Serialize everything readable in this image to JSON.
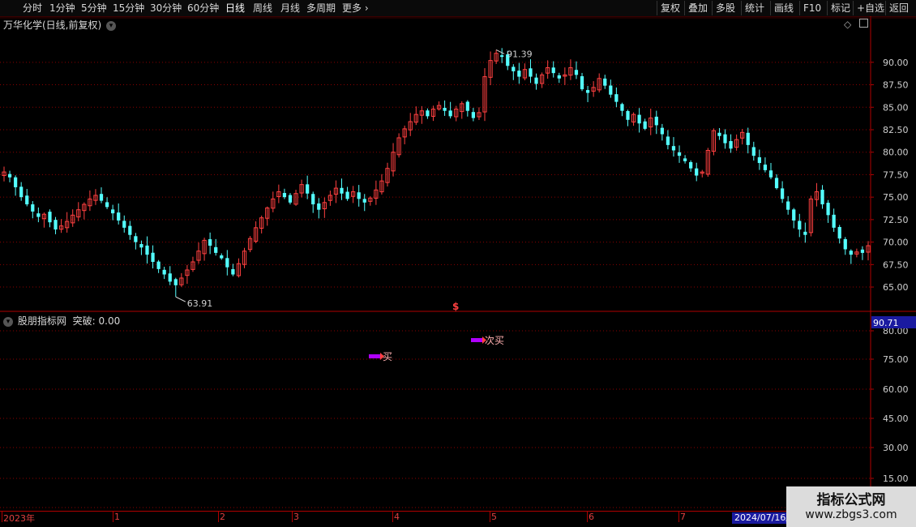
{
  "toolbar": {
    "periods": [
      {
        "label": "分时",
        "active": false
      },
      {
        "label": "1分钟",
        "active": false
      },
      {
        "label": "5分钟",
        "active": false
      },
      {
        "label": "15分钟",
        "active": false
      },
      {
        "label": "30分钟",
        "active": false
      },
      {
        "label": "60分钟",
        "active": false
      },
      {
        "label": "日线",
        "active": true
      },
      {
        "label": "周线",
        "active": false
      },
      {
        "label": "月线",
        "active": false
      },
      {
        "label": "多周期",
        "active": false
      },
      {
        "label": "更多",
        "active": false
      }
    ],
    "right_buttons": [
      "复权",
      "叠加",
      "多股",
      "统计",
      "画线",
      "F10",
      "标记",
      "+自选",
      "返回"
    ]
  },
  "main_panel": {
    "title": "万华化学(日线,前复权)",
    "y_ticks": [
      "90.00",
      "87.50",
      "85.00",
      "82.50",
      "80.00",
      "77.50",
      "75.00",
      "72.50",
      "70.00",
      "67.50",
      "65.00"
    ],
    "high_label": "91.39",
    "low_label": "63.91",
    "marker_symbol": "$"
  },
  "indicator_panel": {
    "title": "股朋指标网",
    "value_label": "突破: 0.00",
    "current_value_box": "90.71",
    "y_ticks": [
      "80.00",
      "75.00",
      "60.00",
      "45.00",
      "30.00",
      "15.00"
    ],
    "signals": [
      {
        "label": "买",
        "color": "#b000ff"
      },
      {
        "label": "次买",
        "color": "#b000ff"
      }
    ]
  },
  "date_axis": {
    "labels": [
      "2023年",
      "1",
      "2",
      "3",
      "4",
      "5",
      "6",
      "7"
    ],
    "current_date": "2024/07/16/"
  },
  "watermark": {
    "line1": "指标公式网",
    "line2": "www.zbgs3.com"
  },
  "colors": {
    "up": "#ff4040",
    "down": "#54ffff",
    "grid": "#8b0000",
    "border": "#b00000"
  },
  "chart_data": {
    "type": "candlestick",
    "title": "万华化学(日线,前复权)",
    "ylim": [
      63.2,
      92.6
    ],
    "high": 91.39,
    "low": 63.91,
    "close": [
      77.8,
      77.2,
      76.1,
      75.0,
      74.2,
      73.4,
      72.8,
      73.1,
      72.2,
      71.4,
      71.8,
      72.3,
      73.0,
      73.6,
      74.2,
      74.8,
      75.2,
      74.6,
      73.9,
      73.2,
      72.4,
      71.6,
      70.8,
      70.0,
      69.4,
      68.6,
      67.8,
      67.0,
      66.4,
      65.6,
      65.2,
      66.0,
      66.9,
      67.8,
      69.0,
      70.2,
      69.6,
      68.8,
      68.2,
      67.2,
      66.4,
      67.6,
      69.0,
      70.4,
      71.6,
      72.7,
      73.8,
      74.8,
      75.6,
      75.0,
      74.4,
      75.4,
      76.4,
      75.4,
      74.2,
      73.6,
      74.4,
      75.2,
      76.0,
      75.4,
      74.8,
      75.6,
      74.8,
      74.4,
      74.9,
      75.8,
      76.8,
      78.2,
      80.0,
      81.6,
      82.6,
      83.4,
      84.2,
      84.6,
      84.0,
      84.8,
      85.2,
      84.6,
      84.0,
      84.8,
      85.4,
      84.6,
      83.8,
      84.4,
      88.4,
      90.2,
      91.0,
      90.6,
      89.6,
      89.0,
      88.4,
      89.2,
      88.4,
      87.6,
      88.6,
      89.4,
      88.8,
      88.2,
      88.6,
      89.4,
      88.6,
      87.0,
      86.6,
      87.2,
      88.2,
      87.4,
      86.4,
      85.6,
      84.6,
      83.6,
      84.2,
      83.2,
      82.6,
      83.8,
      83.0,
      82.0,
      80.8,
      80.2,
      79.6,
      79.0,
      78.2,
      77.4,
      77.8,
      80.2,
      82.4,
      81.8,
      81.0,
      80.4,
      81.4,
      82.2,
      80.8,
      79.6,
      78.8,
      78.0,
      77.2,
      76.0,
      74.8,
      73.6,
      72.4,
      71.4,
      70.8,
      74.8,
      75.6,
      74.2,
      73.0,
      71.6,
      70.4,
      69.2,
      68.6,
      68.9,
      68.8,
      69.6
    ]
  }
}
